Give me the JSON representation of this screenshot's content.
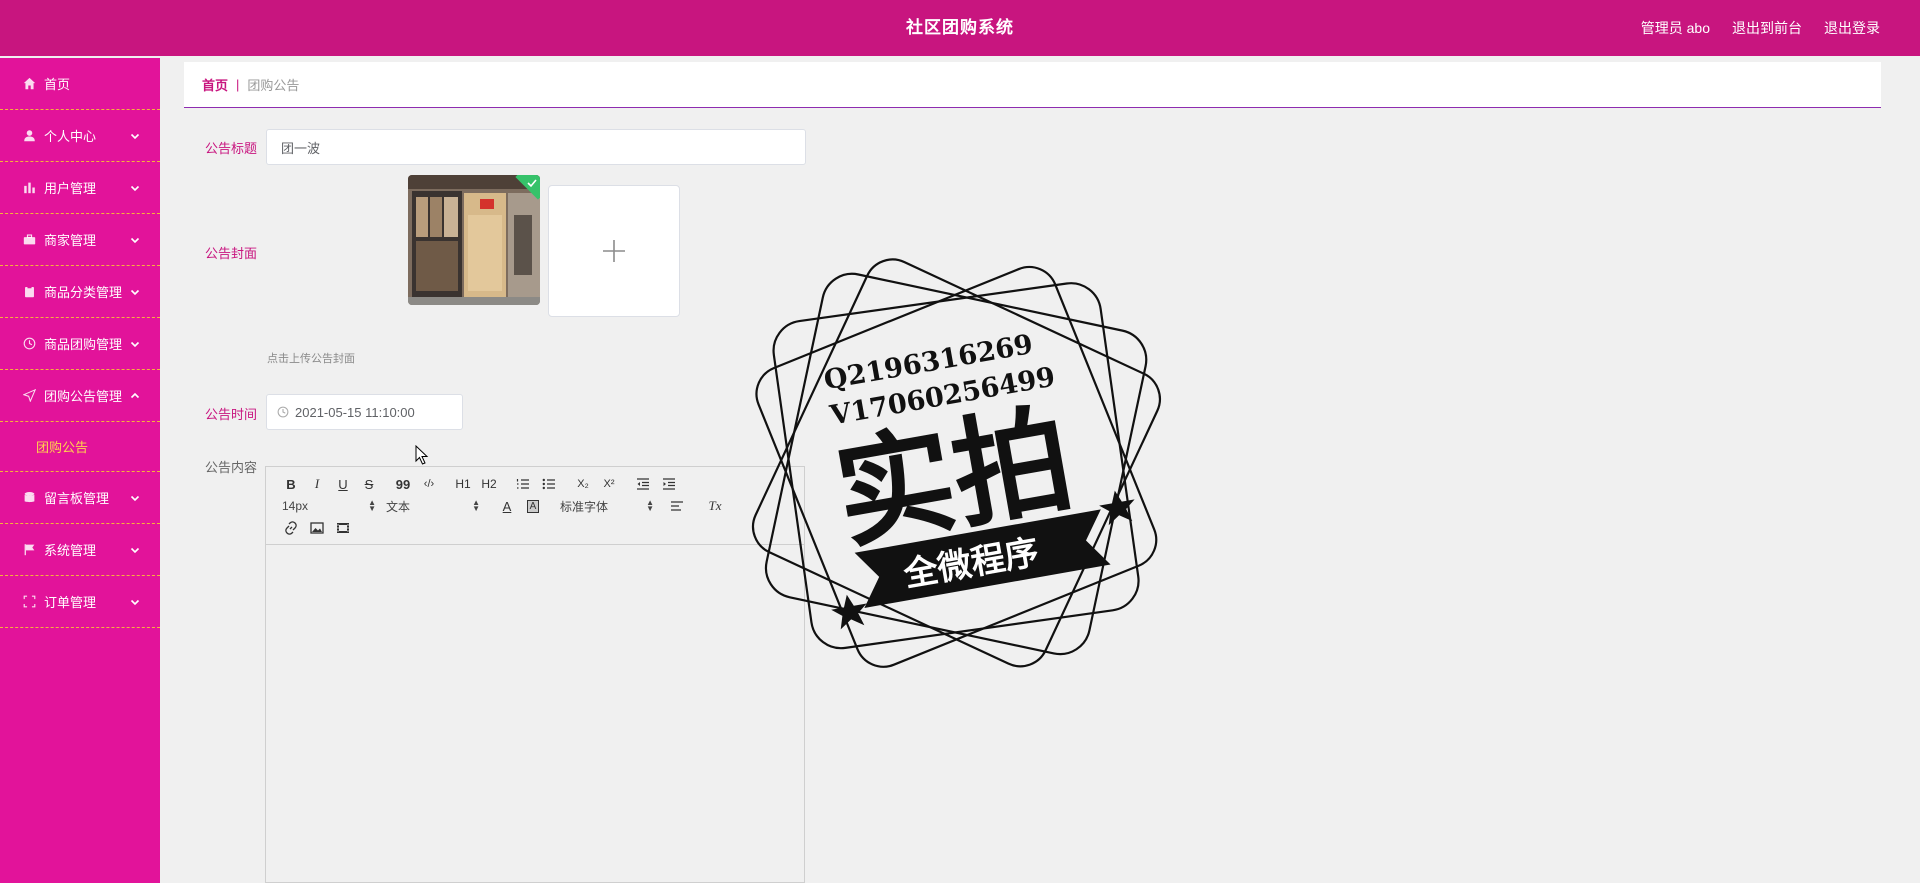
{
  "header": {
    "title": "社区团购系统",
    "admin_label": "管理员 abo",
    "to_front": "退出到前台",
    "logout": "退出登录"
  },
  "sidebar": {
    "items": [
      {
        "label": "首页",
        "icon": "home-icon"
      },
      {
        "label": "个人中心",
        "icon": "user-icon"
      },
      {
        "label": "用户管理",
        "icon": "bar-chart-icon"
      },
      {
        "label": "商家管理",
        "icon": "briefcase-icon"
      },
      {
        "label": "商品分类管理",
        "icon": "clipboard-icon"
      },
      {
        "label": "商品团购管理",
        "icon": "clock-icon"
      },
      {
        "label": "团购公告管理",
        "icon": "send-icon"
      },
      {
        "label": "留言板管理",
        "icon": "database-icon"
      },
      {
        "label": "系统管理",
        "icon": "flag-icon"
      },
      {
        "label": "订单管理",
        "icon": "scan-icon"
      }
    ],
    "sub_item": "团购公告"
  },
  "breadcrumb": {
    "home": "首页",
    "separator": "|",
    "current": "团购公告"
  },
  "form": {
    "title_label": "公告标题",
    "title_value": "团一波",
    "cover_label": "公告封面",
    "cover_hint": "点击上传公告封面",
    "time_label": "公告时间",
    "time_value": "2021-05-15 11:10:00",
    "content_label": "公告内容"
  },
  "editor": {
    "size_value": "14px",
    "format_value": "文本",
    "font_value": "标准字体",
    "buttons": {
      "bold": "B",
      "italic": "I",
      "underline": "U",
      "strike": "S",
      "quote": "99",
      "code": "‹/›",
      "h1": "H1",
      "h2": "H2",
      "sub": "X₂",
      "sup": "X²",
      "text_color": "A",
      "bg_color": "A",
      "clear": "Tx"
    }
  },
  "watermark": {
    "line1": "Q2196316269",
    "line2": "V17060256499",
    "big": "实拍",
    "banner": "全微程序"
  },
  "colors": {
    "header": "#c8157f",
    "sidebar": "#e2139a",
    "accent": "#c8157f",
    "sub_active": "#ffd34d",
    "divider": "#f7b23a"
  }
}
